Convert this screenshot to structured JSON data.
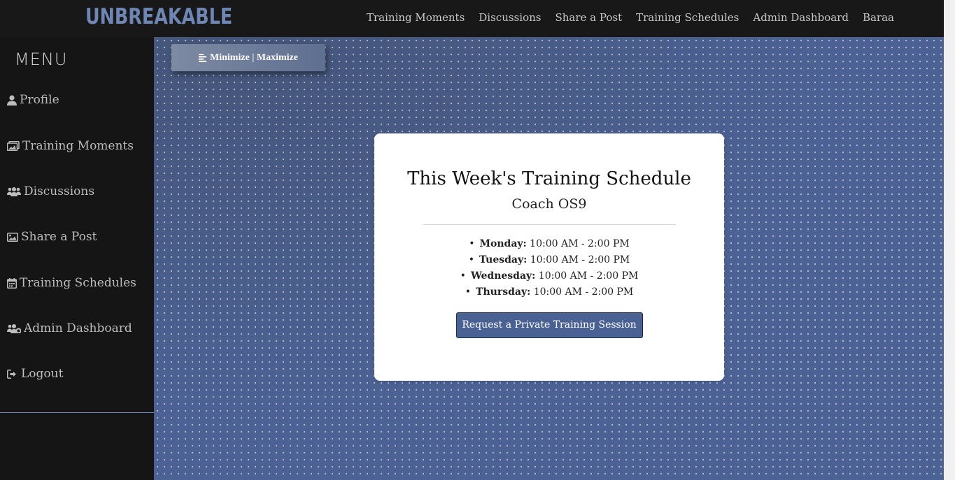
{
  "brand": {
    "logo_text": "UNBREAKABLE",
    "logo_color": "#6e86b3"
  },
  "topnav": {
    "items": [
      "Training Moments",
      "Discussions",
      "Share a Post",
      "Training Schedules",
      "Admin Dashboard",
      "Baraa"
    ]
  },
  "sidebar": {
    "title": "MENU",
    "items": [
      {
        "label": "Profile",
        "icon": "user-icon"
      },
      {
        "label": "Training Moments",
        "icon": "images-icon"
      },
      {
        "label": "Discussions",
        "icon": "users-icon"
      },
      {
        "label": "Share a Post",
        "icon": "image-icon"
      },
      {
        "label": "Training Schedules",
        "icon": "calendar-icon"
      },
      {
        "label": "Admin Dashboard",
        "icon": "users-cog-icon"
      },
      {
        "label": "Logout",
        "icon": "sign-out-icon"
      }
    ]
  },
  "toggle": {
    "label": "Minimize | Maximize",
    "icon": "align-left-icon"
  },
  "card": {
    "title": "This Week's Training Schedule",
    "coach": "Coach OS9",
    "schedule": [
      {
        "day": "Monday:",
        "time": " 10:00 AM - 2:00 PM"
      },
      {
        "day": "Tuesday:",
        "time": " 10:00 AM - 2:00 PM"
      },
      {
        "day": "Wednesday:",
        "time": " 10:00 AM - 2:00 PM"
      },
      {
        "day": "Thursday:",
        "time": " 10:00 AM - 2:00 PM"
      }
    ],
    "button_label": "Request a Private Training Session"
  },
  "colors": {
    "accent": "#4a6194",
    "background": "#4c6294",
    "sidebar": "#151515"
  }
}
